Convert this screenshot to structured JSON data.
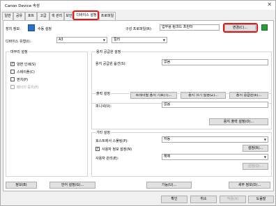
{
  "window": {
    "title": "Canon Device 속성",
    "close_glyph": "✕"
  },
  "tabs": [
    "일반",
    "공유",
    "포트",
    "고급",
    "색 관리",
    "보안",
    "디바이스 설정",
    "프로파일"
  ],
  "top": {
    "device_info_label": "장치 정보:",
    "manual_setting": "수동 설정",
    "config_profile_label": "구성 프로파일(R):",
    "config_profile_value": "업무용 링크드 프린터",
    "change_button": "변경(C)..."
  },
  "device_selector": {
    "label": "디바이스 유형(I):",
    "value": "A3",
    "value2": "컬러"
  },
  "output_options": {
    "caption": "마무리 설정",
    "items": [
      {
        "label": "양면 인쇄(S)",
        "checked": true
      },
      {
        "label": "스테이플(C)",
        "checked": false
      },
      {
        "label": "펀치(P)",
        "checked": false
      },
      {
        "label": "페이지 중지(F)",
        "checked": false,
        "disabled": true
      }
    ]
  },
  "paper_source": {
    "caption": "용지 공급원 설정",
    "option_label": "용지 공급원 옵션(S):",
    "option_value": "없음",
    "buttons": [
      "트레이별 용지 기호(T)...",
      "용지 크기 설정(Z)...",
      "용지 공급원(E)..."
    ]
  },
  "output_settings": {
    "caption": "출력 설정",
    "label": "피니셔(U):",
    "value": "없음",
    "button": "용지 출력 설정(O)..."
  },
  "other": {
    "caption": "기타 설정",
    "spool_label": "호스트에서 스풀링(P):",
    "spool_value": "자동",
    "user_mgmt_label": "사용자 정보 설정(N)",
    "user_mgmt_checked": true,
    "user_mgmt_button": "설정(R)...",
    "dept_label": "사용자 관리(E):",
    "dept_value": "해제",
    "dept_button": "설정(Q)..."
  },
  "footer_row": [
    "정보(B)",
    "언어 설정(G)...",
    "기능(U)...",
    "세부 정보(D)..."
  ],
  "dialog_buttons": [
    "확인",
    "취소",
    "적용(A)",
    "도움말"
  ]
}
